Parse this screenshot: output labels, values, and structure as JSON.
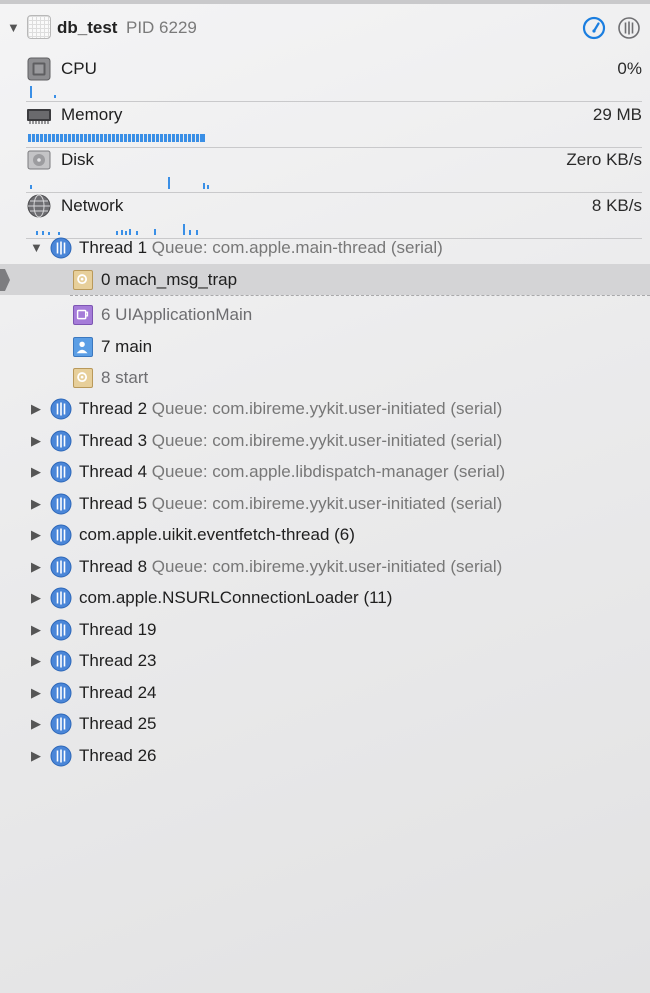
{
  "process": {
    "name": "db_test",
    "pid": "PID 6229"
  },
  "gauges": [
    {
      "label": "CPU",
      "value": "0%",
      "icon": "cpu-icon"
    },
    {
      "label": "Memory",
      "value": "29 MB",
      "icon": "memory-chip-icon"
    },
    {
      "label": "Disk",
      "value": "Zero KB/s",
      "icon": "disk-icon"
    },
    {
      "label": "Network",
      "value": "8 KB/s",
      "icon": "network-globe-icon"
    }
  ],
  "main_thread": {
    "name": "Thread 1",
    "queue": "Queue: com.apple.main-thread (serial)",
    "frames": [
      {
        "label": "0 mach_msg_trap",
        "icon": "system-frame-icon"
      },
      {
        "label": "6 UIApplicationMain",
        "icon": "uikit-frame-icon"
      },
      {
        "label": "7 main",
        "icon": "user-frame-icon"
      },
      {
        "label": "8 start",
        "icon": "system-frame-icon"
      }
    ]
  },
  "threads": [
    {
      "name": "Thread 2",
      "queue": "Queue: com.ibireme.yykit.user-initiated (serial)"
    },
    {
      "name": "Thread 3",
      "queue": "Queue: com.ibireme.yykit.user-initiated (serial)"
    },
    {
      "name": "Thread 4",
      "queue": "Queue: com.apple.libdispatch-manager (serial)"
    },
    {
      "name": "Thread 5",
      "queue": "Queue: com.ibireme.yykit.user-initiated (serial)"
    },
    {
      "name": "com.apple.uikit.eventfetch-thread (6)",
      "queue": ""
    },
    {
      "name": "Thread 8",
      "queue": "Queue: com.ibireme.yykit.user-initiated (serial)"
    },
    {
      "name": "com.apple.NSURLConnectionLoader (11)",
      "queue": ""
    },
    {
      "name": "Thread 19",
      "queue": ""
    },
    {
      "name": "Thread 23",
      "queue": ""
    },
    {
      "name": "Thread 24",
      "queue": ""
    },
    {
      "name": "Thread 25",
      "queue": ""
    },
    {
      "name": "Thread 26",
      "queue": ""
    }
  ],
  "colors": {
    "accent": "#1a7ee0",
    "spark": "#3a8fe6",
    "thread_icon": "#4a86d8",
    "selection": "#d4d4d6"
  }
}
